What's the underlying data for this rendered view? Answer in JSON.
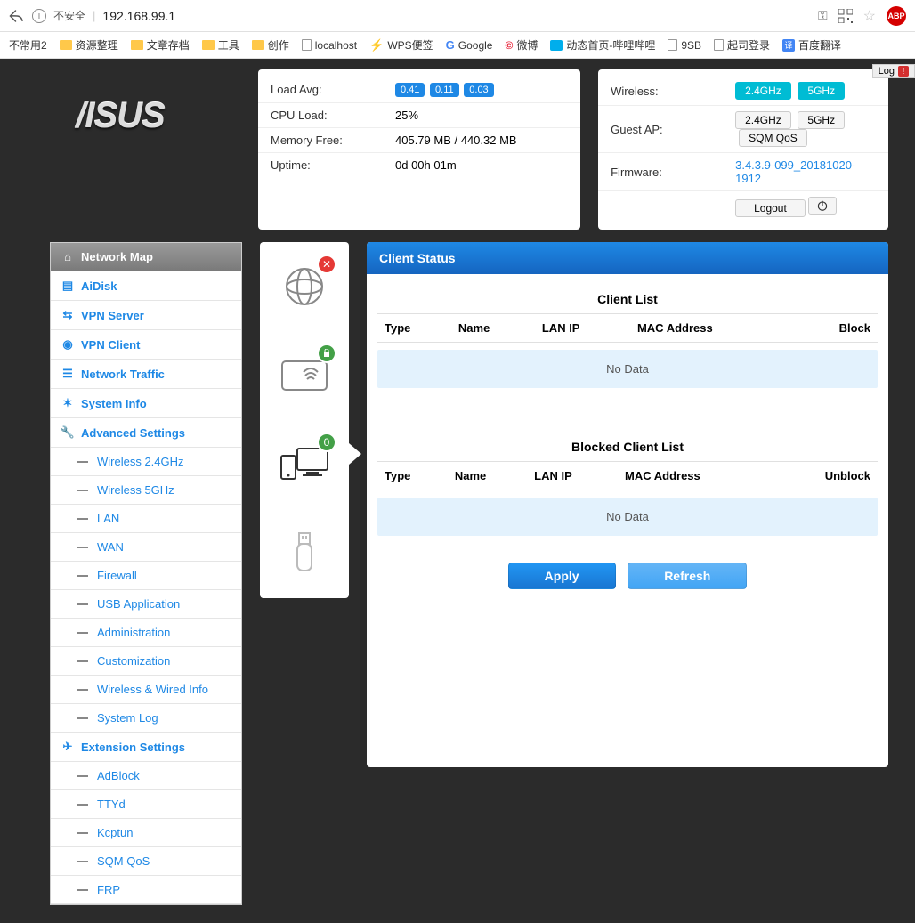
{
  "browser": {
    "insecure": "不安全",
    "url": "192.168.99.1",
    "abp": "ABP",
    "log_tab": "Log"
  },
  "bookmarks": {
    "b0": "不常用2",
    "b1": "资源整理",
    "b2": "文章存档",
    "b3": "工具",
    "b4": "创作",
    "b5": "localhost",
    "b6": "WPS便签",
    "b7": "Google",
    "b8": "微博",
    "b9": "动态首页-哔哩哔哩",
    "b10": "9SB",
    "b11": "起司登录",
    "b12": "百度翻译"
  },
  "logo": "/ISUS",
  "stats": {
    "loadavg_label": "Load Avg:",
    "loadavg_1": "0.41",
    "loadavg_2": "0.11",
    "loadavg_3": "0.03",
    "cpu_label": "CPU Load:",
    "cpu_val": "25%",
    "mem_label": "Memory Free:",
    "mem_val": "405.79 MB / 440.32 MB",
    "uptime_label": "Uptime:",
    "uptime_val": "0d 00h 01m"
  },
  "radio": {
    "wireless_label": "Wireless:",
    "w24": "2.4GHz",
    "w5": "5GHz",
    "guest_label": "Guest AP:",
    "g24": "2.4GHz",
    "g5": "5GHz",
    "sqm": "SQM QoS",
    "fw_label": "Firmware:",
    "fw_val": "3.4.3.9-099_20181020-1912",
    "logout": "Logout"
  },
  "sidebar": {
    "network_map": "Network Map",
    "aidisk": "AiDisk",
    "vpn_server": "VPN Server",
    "vpn_client": "VPN Client",
    "network_traffic": "Network Traffic",
    "system_info": "System Info",
    "advanced": "Advanced Settings",
    "w24": "Wireless 2.4GHz",
    "w5": "Wireless 5GHz",
    "lan": "LAN",
    "wan": "WAN",
    "firewall": "Firewall",
    "usb": "USB Application",
    "admin": "Administration",
    "custom": "Customization",
    "wwinfo": "Wireless & Wired Info",
    "syslog": "System Log",
    "extension": "Extension Settings",
    "adblock": "AdBlock",
    "ttyd": "TTYd",
    "kcptun": "Kcptun",
    "sqm": "SQM QoS",
    "frp": "FRP"
  },
  "iconcol": {
    "clients_badge": "0"
  },
  "panel": {
    "header": "Client Status",
    "client_list": "Client List",
    "blocked_list": "Blocked Client List",
    "col_type": "Type",
    "col_name": "Name",
    "col_lanip": "LAN IP",
    "col_mac": "MAC Address",
    "col_block": "Block",
    "col_unblock": "Unblock",
    "nodata": "No Data",
    "apply": "Apply",
    "refresh": "Refresh"
  }
}
